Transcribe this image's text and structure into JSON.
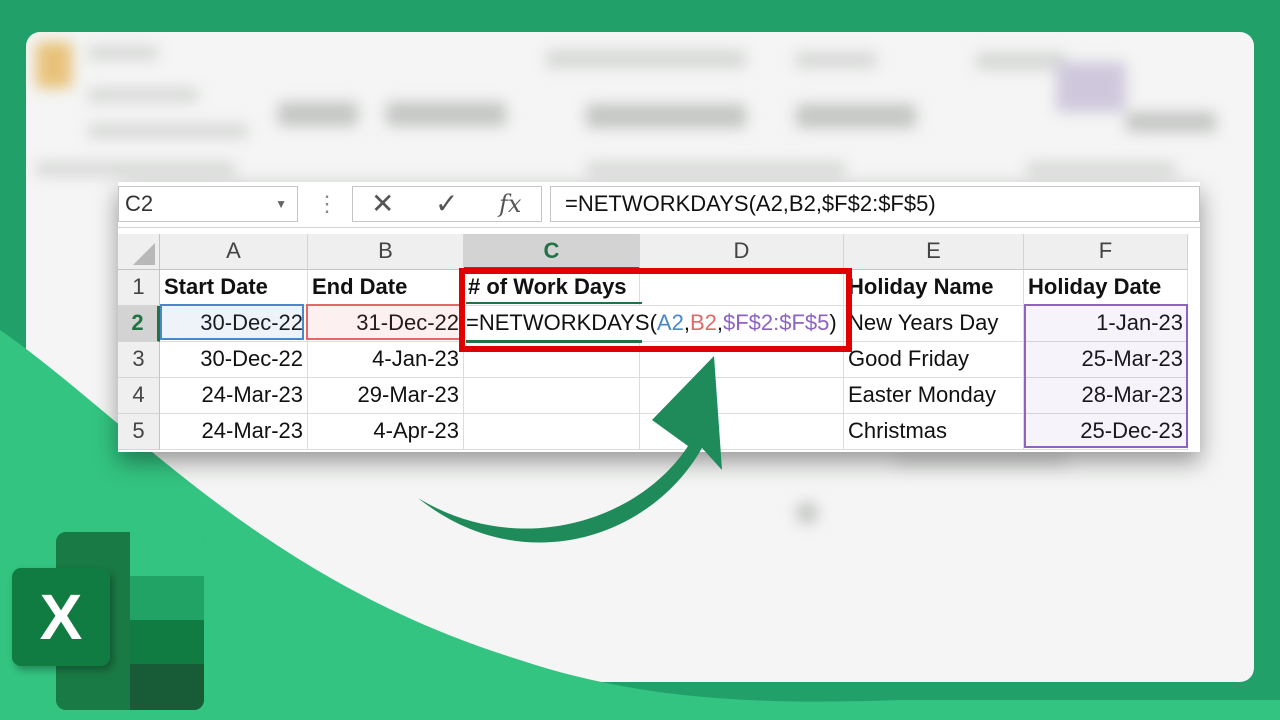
{
  "name_box": "C2",
  "formula_bar": {
    "cancel_symbol": "✕",
    "enter_symbol": "✓",
    "fx_symbol": "fx",
    "formula": "=NETWORKDAYS(A2,B2,$F$2:$F$5)"
  },
  "columns": [
    "A",
    "B",
    "C",
    "D",
    "E",
    "F"
  ],
  "rows": [
    "1",
    "2",
    "3",
    "4",
    "5"
  ],
  "cells": {
    "A1": "Start Date",
    "B1": "End Date",
    "C1": "# of Work Days",
    "D1": "",
    "E1": "Holiday Name",
    "F1": "Holiday Date",
    "A2": "30-Dec-22",
    "B2": "31-Dec-22",
    "C2": "",
    "D2": "",
    "E2": "New Years Day",
    "F2": "1-Jan-23",
    "A3": "30-Dec-22",
    "B3": "4-Jan-23",
    "C3": "",
    "D3": "",
    "E3": "Good Friday",
    "F3": "25-Mar-23",
    "A4": "24-Mar-23",
    "B4": "29-Mar-23",
    "C4": "",
    "D4": "",
    "E4": "Easter Monday",
    "F4": "28-Mar-23",
    "A5": "24-Mar-23",
    "B5": "4-Apr-23",
    "C5": "",
    "D5": "",
    "E5": "Christmas",
    "F5": "25-Dec-23"
  },
  "editing_formula": {
    "prefix": "=NETWORKDAYS(",
    "arg1": "A2",
    "sep1": ",",
    "arg2": "B2",
    "sep2": ",",
    "arg3": "$F$2:$F$5",
    "suffix": ")"
  },
  "colors": {
    "background_green": "#22a06a",
    "excel_green": "#217346",
    "highlight_red": "#e00000",
    "ref_blue": "#4a86c8",
    "ref_red": "#e06a6a",
    "ref_purple": "#8e62c0"
  },
  "logo": {
    "letter": "X",
    "icon": "excel-logo-icon"
  }
}
